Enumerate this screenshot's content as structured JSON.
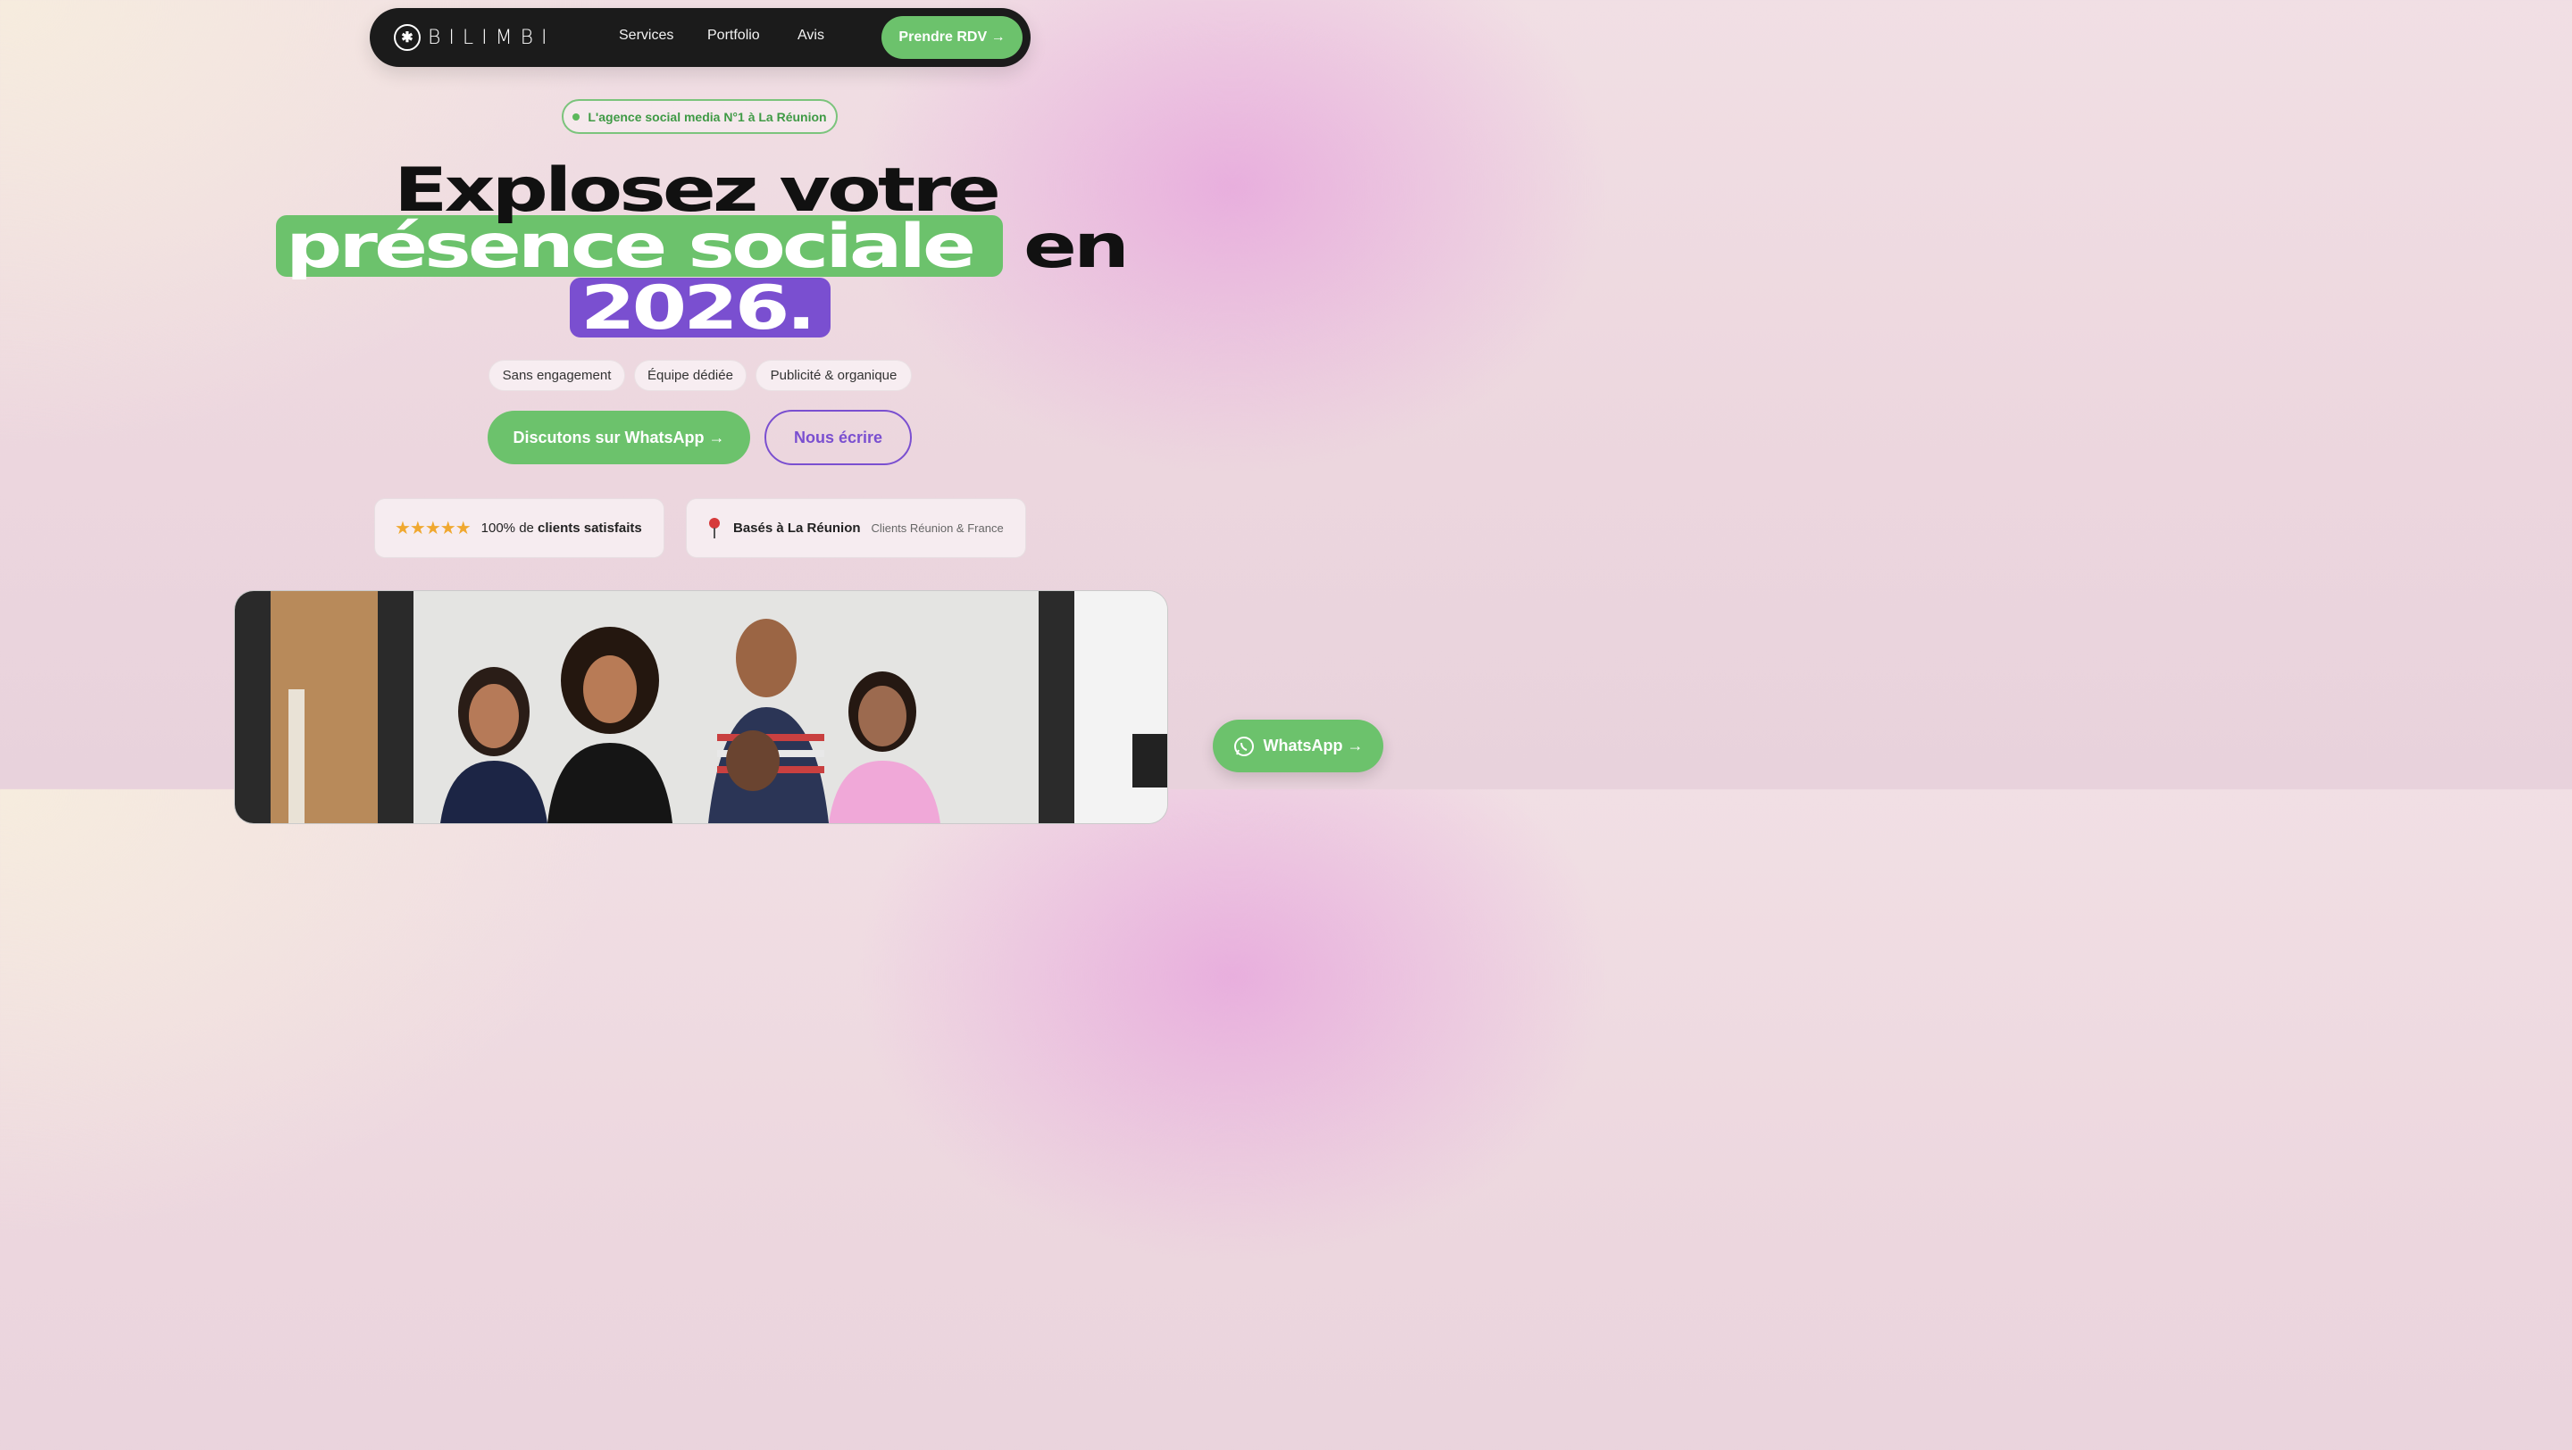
{
  "nav": {
    "logo_text": "BILIMBI",
    "links": [
      "Services",
      "Portfolio",
      "Avis"
    ],
    "cta": "Prendre RDV →"
  },
  "hero": {
    "badge": "L'agence social media N°1 à La Réunion",
    "headline": {
      "line1": "Explosez votre",
      "highlight_green": "présence sociale",
      "line2_rest": "en",
      "highlight_purple": "2026."
    },
    "pills": [
      "Sans engagement",
      "Équipe dédiée",
      "Publicité & organique"
    ],
    "primary_button": "Discutons sur WhatsApp →",
    "secondary_button": "Nous écrire"
  },
  "stats": {
    "rating": {
      "stars": "★★★★★",
      "prefix": "100% de",
      "bold": "clients satisfaits"
    },
    "location": {
      "bold": "Basés à La Réunion",
      "muted": "Clients Réunion & France"
    }
  },
  "floating_whatsapp": "WhatsApp →",
  "colors": {
    "green": "#6cc26c",
    "purple": "#7a4fd0",
    "nav_bg": "#1b1b1b"
  }
}
